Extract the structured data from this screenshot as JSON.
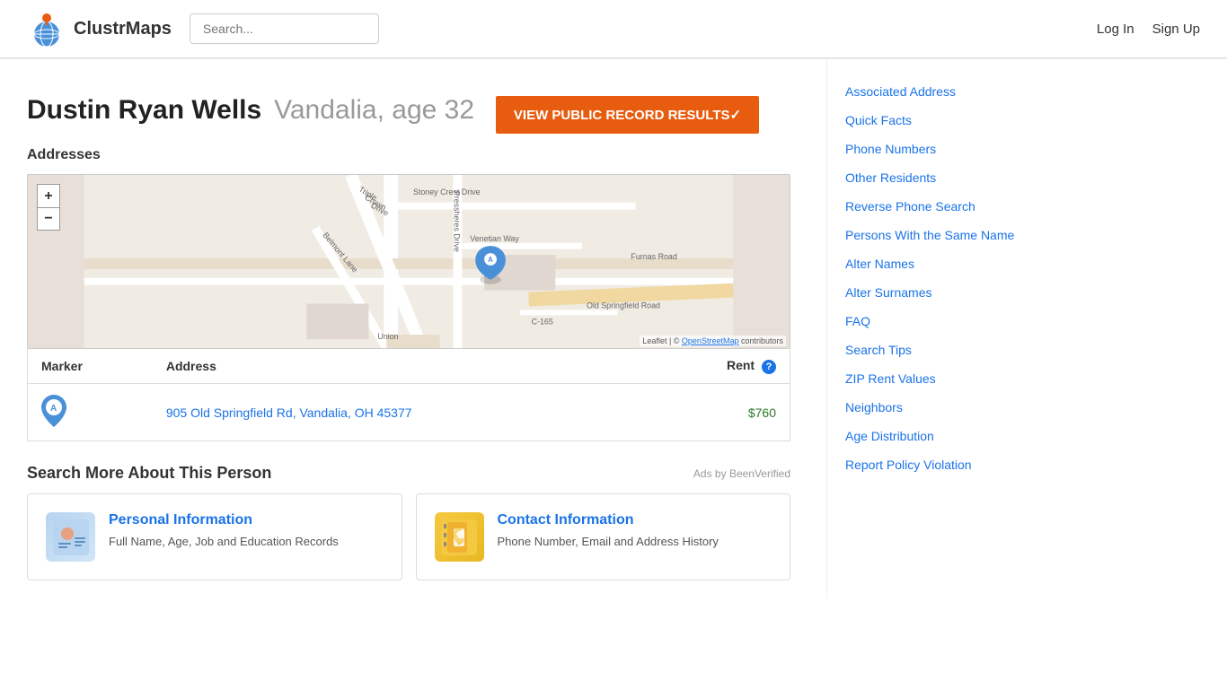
{
  "header": {
    "logo_text": "ClustrMaps",
    "search_placeholder": "Search...",
    "nav": {
      "login": "Log In",
      "signup": "Sign Up"
    }
  },
  "person": {
    "name": "Dustin Ryan Wells",
    "meta": "Vandalia, age 32",
    "view_record_btn": "VIEW PUBLIC RECORD RESULTS✓"
  },
  "addresses_section": {
    "title": "Addresses",
    "table": {
      "headers": {
        "marker": "Marker",
        "address": "Address",
        "rent": "Rent"
      },
      "rows": [
        {
          "marker": "A",
          "address": "905 Old Springfield Rd, Vandalia, OH 45377",
          "rent": "$760"
        }
      ]
    }
  },
  "search_more": {
    "title": "Search More About This Person",
    "ads_label": "Ads by BeenVerified",
    "cards": [
      {
        "id": "personal",
        "title": "Personal Information",
        "description": "Full Name, Age, Job and Education Records"
      },
      {
        "id": "contact",
        "title": "Contact Information",
        "description": "Phone Number, Email and Address History"
      }
    ]
  },
  "sidebar": {
    "links": [
      {
        "id": "associated-address",
        "label": "Associated Address"
      },
      {
        "id": "quick-facts",
        "label": "Quick Facts"
      },
      {
        "id": "phone-numbers",
        "label": "Phone Numbers"
      },
      {
        "id": "other-residents",
        "label": "Other Residents"
      },
      {
        "id": "reverse-phone-search",
        "label": "Reverse Phone Search"
      },
      {
        "id": "persons-same-name",
        "label": "Persons With the Same Name"
      },
      {
        "id": "alter-names",
        "label": "Alter Names"
      },
      {
        "id": "alter-surnames",
        "label": "Alter Surnames"
      },
      {
        "id": "faq",
        "label": "FAQ"
      },
      {
        "id": "search-tips",
        "label": "Search Tips"
      },
      {
        "id": "zip-rent-values",
        "label": "ZIP Rent Values"
      },
      {
        "id": "neighbors",
        "label": "Neighbors"
      },
      {
        "id": "age-distribution",
        "label": "Age Distribution"
      },
      {
        "id": "report-policy",
        "label": "Report Policy Violation"
      }
    ]
  },
  "map": {
    "zoom_in": "+",
    "zoom_out": "−",
    "attribution": "Leaflet | © OpenStreetMap contributors"
  }
}
